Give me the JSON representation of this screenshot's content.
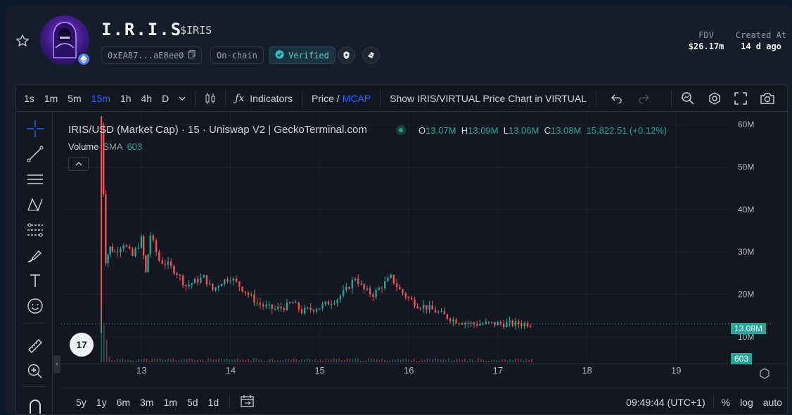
{
  "token": {
    "name": "I.R.I.S",
    "symbol": "$IRIS",
    "address": "0xEA87...aE8ee0",
    "onchain_label": "On-chain",
    "verified_label": "Verified"
  },
  "stats": [
    {
      "label": "FDV",
      "value": "$26.17m"
    },
    {
      "label": "Created At",
      "value": "14 d ago"
    }
  ],
  "toolbar": {
    "intervals": [
      "1s",
      "1m",
      "5m",
      "15m",
      "1h",
      "4h",
      "D"
    ],
    "active_interval": "15m",
    "indicators_label": "Indicators",
    "price_label": "Price /",
    "mcap_label": "MCAP",
    "show_label": "Show IRIS/VIRTUAL Price Chart in VIRTUAL"
  },
  "legend": {
    "title": "IRIS/USD (Market Cap) · 15 · Uniswap V2 | GeckoTerminal.com",
    "o_label": "O",
    "o_value": "13.07M",
    "h_label": "H",
    "h_value": "13.09M",
    "l_label": "L",
    "l_value": "13.06M",
    "c_label": "C",
    "c_value": "13.08M",
    "change": "15,822.51 (+0.12%)",
    "volume_label": "Volume",
    "sma_label": "SMA",
    "volume_value": "603"
  },
  "price_axis": {
    "labels": [
      "60M",
      "50M",
      "40M",
      "30M",
      "20M",
      "10M"
    ],
    "current_tag": "13.08M",
    "volume_tag": "603"
  },
  "time_axis": {
    "labels": [
      "13",
      "14",
      "15",
      "16",
      "17",
      "18",
      "19"
    ]
  },
  "bottom_bar": {
    "ranges": [
      "5y",
      "1y",
      "6m",
      "3m",
      "1m",
      "5d",
      "1d"
    ],
    "clock": "09:49:44 (UTC+1)",
    "percent_label": "%",
    "log_label": "log",
    "auto_label": "auto"
  },
  "chart_data": {
    "type": "candlestick",
    "title": "IRIS/USD (Market Cap) · 15 · Uniswap V2 | GeckoTerminal.com",
    "x_unit": "day",
    "xlim": [
      12.1,
      19.6
    ],
    "ylim": [
      5,
      63
    ],
    "y_unit": "M",
    "series": [
      {
        "name": "Market Cap",
        "x": [
          12.55,
          12.6,
          12.65,
          12.7,
          12.8,
          12.9,
          13.0,
          13.05,
          13.1,
          13.2,
          13.3,
          13.4,
          13.5,
          13.6,
          13.7,
          13.8,
          13.9,
          14.0,
          14.1,
          14.2,
          14.3,
          14.4,
          14.5,
          14.6,
          14.7,
          14.8,
          14.9,
          15.0,
          15.1,
          15.2,
          15.3,
          15.4,
          15.5,
          15.6,
          15.7,
          15.8,
          15.9,
          16.0,
          16.1,
          16.2,
          16.3,
          16.4,
          16.5,
          16.6,
          16.7,
          16.8,
          16.9,
          17.0,
          17.1,
          17.2,
          17.3,
          17.4
        ],
        "y": [
          60,
          28,
          31,
          30,
          32,
          29,
          33,
          25,
          34,
          28,
          27,
          25,
          22,
          23,
          24,
          21,
          23,
          24,
          22,
          20,
          18,
          17,
          16.5,
          17,
          18,
          16,
          16.5,
          17,
          18,
          19,
          21,
          24,
          21,
          20,
          22,
          24,
          21,
          19,
          17.5,
          17,
          16,
          15,
          14,
          13.5,
          13.08,
          13.08,
          13.08,
          13.08,
          13.08,
          13.08,
          13.08,
          13.08
        ]
      }
    ],
    "volume_sma": 603
  }
}
